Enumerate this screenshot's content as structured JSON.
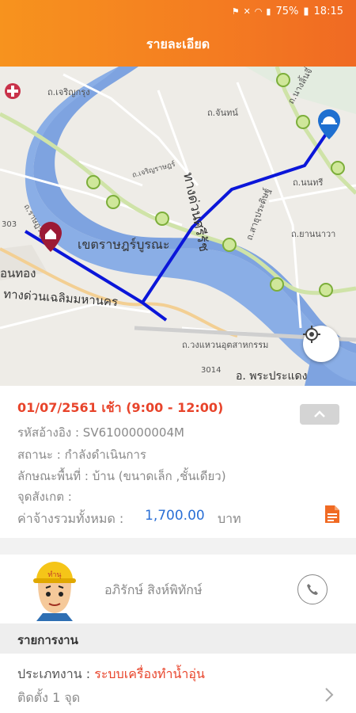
{
  "status_bar": {
    "battery": "75%",
    "time": "18:15"
  },
  "header": {
    "title": "รายละเอียด"
  },
  "map": {
    "labels": {
      "road_north": "ทางด่วนศรีรัช",
      "road_south": "ทางด่วนเฉลิมมหานคร",
      "district": "เขตราษฎร์บูรณะ",
      "bottom_road": "ถ.วงแหวนอุตสาหกรรม",
      "bottom_town": "อ. พระประแดง",
      "route_314": "3014",
      "road_jan": "ถ.จันทน์",
      "road_charoenkrung": "ถ.เจริญกรุง",
      "road_naradhiwas": "ถ.นางลิ้นจี่",
      "road_nonsi": "ถ.นนทรี",
      "road_sathupradit": "ถ.สาธุประดิษฐ์",
      "road_yannawa": "ถ.ยานนาวา",
      "left_edge": "อนทอง",
      "route_303": "303",
      "road_ratburana": "ถ.ราษฎร์บูรณะ",
      "road_mid": "ถ.เจริญราษฎร์"
    }
  },
  "detail": {
    "date_line": "01/07/2561 เช้า (9:00 - 12:00)",
    "ref_label": "รหัสอ้างอิง :",
    "ref_value": "SV6100000004M",
    "status_label": "สถานะ :",
    "status_value": "กำลังดำเนินการ",
    "area_label": "ลักษณะพื้นที่ :",
    "area_value": "บ้าน (ขนาดเล็ก ,ชั้นเดียว)",
    "landmark_label": "จุดสังเกต :",
    "landmark_value": "",
    "total_label": "ค่าจ้างรวมทั้งหมด :",
    "total_amount": "1,700.00",
    "currency": "บาท"
  },
  "technician": {
    "name": "อภิรักษ์ สิงห์พิทักษ์",
    "helmet_text": "ทำนุ"
  },
  "jobs": {
    "section_title": "รายการงาน",
    "items": [
      {
        "type_label": "ประเภทงาน :",
        "type_value": "ระบบเครื่องทำน้ำอุ่น",
        "qty": "ติดตั้ง 1 จุด"
      }
    ]
  },
  "colors": {
    "accent": "#f47c21",
    "red_text": "#e8442b",
    "amount_blue": "#2a6fd6",
    "route": "#0b16d9",
    "river": "#7ea3e0"
  }
}
